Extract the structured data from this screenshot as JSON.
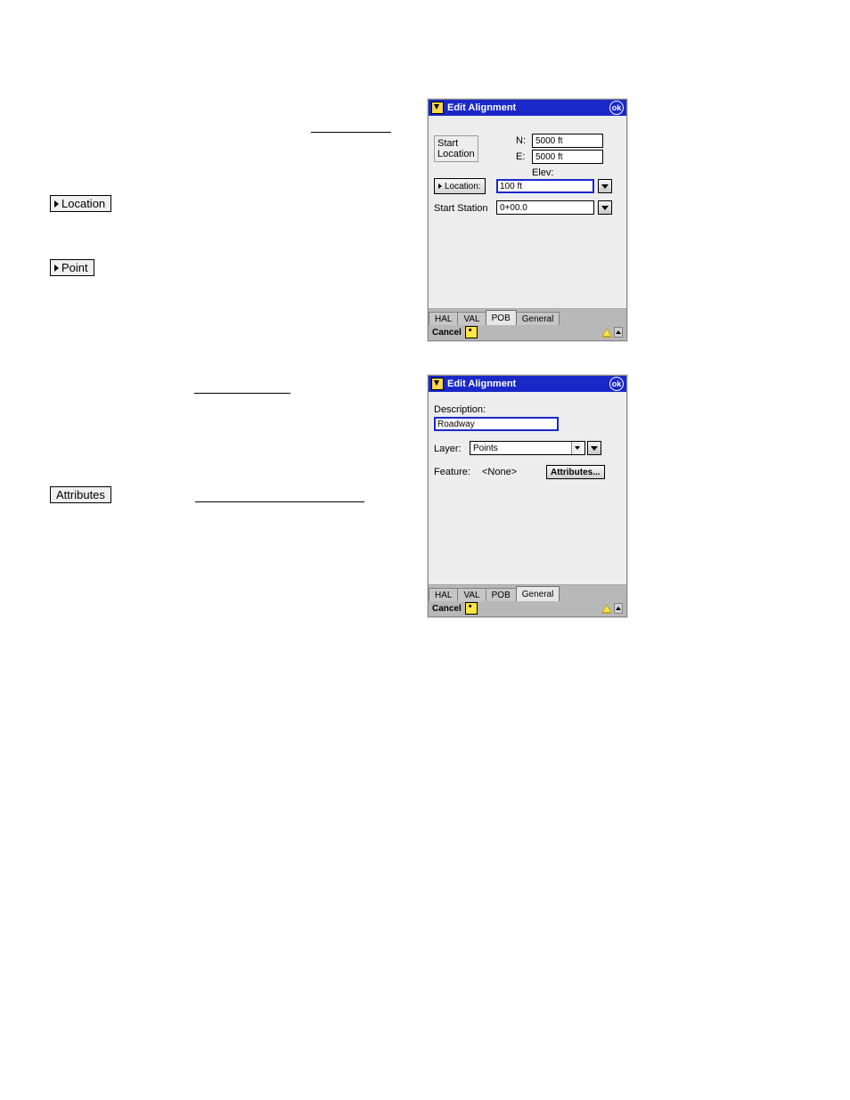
{
  "inline_buttons": {
    "location": "Location",
    "point": "Point",
    "attributes": "Attributes"
  },
  "window1": {
    "title": "Edit Alignment",
    "ok": "ok",
    "start_label1": "Start",
    "start_label2": "Location",
    "n_label": "N:",
    "n_value": "5000 ft",
    "e_label": "E:",
    "e_value": "5000 ft",
    "elev_label": "Elev:",
    "location_btn": "Location:",
    "elev_value": "100 ft",
    "start_station_label": "Start Station",
    "start_station_value": "0+00.0",
    "tabs": [
      "HAL",
      "VAL",
      "POB",
      "General"
    ],
    "cancel": "Cancel"
  },
  "window2": {
    "title": "Edit Alignment",
    "ok": "ok",
    "description_label": "Description:",
    "description_value": "Roadway",
    "layer_label": "Layer:",
    "layer_value": "Points",
    "feature_label": "Feature:",
    "feature_value": "<None>",
    "attributes_btn": "Attributes...",
    "tabs": [
      "HAL",
      "VAL",
      "POB",
      "General"
    ],
    "cancel": "Cancel"
  }
}
